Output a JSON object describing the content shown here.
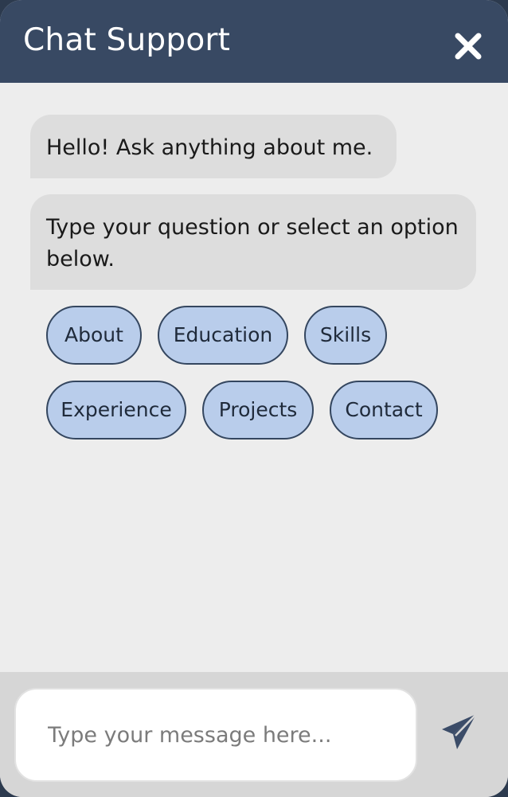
{
  "header": {
    "title": "Chat Support",
    "close_icon": "close-icon"
  },
  "messages": [
    {
      "sender": "bot",
      "text": "Hello! Ask anything about me."
    },
    {
      "sender": "bot",
      "text": "Type your question or select an option below."
    }
  ],
  "options": [
    "About",
    "Education",
    "Skills",
    "Experience",
    "Projects",
    "Contact"
  ],
  "input": {
    "value": "",
    "placeholder": "Type your message here..."
  },
  "send": {
    "icon": "send-icon"
  },
  "colors": {
    "header_bg": "#384963",
    "body_bg": "#ededed",
    "bubble_bg": "#dddddd",
    "option_bg": "#b9cdeb",
    "option_border": "#34465f",
    "footer_bg": "#d6d6d6",
    "send_icon": "#3b4c68"
  }
}
